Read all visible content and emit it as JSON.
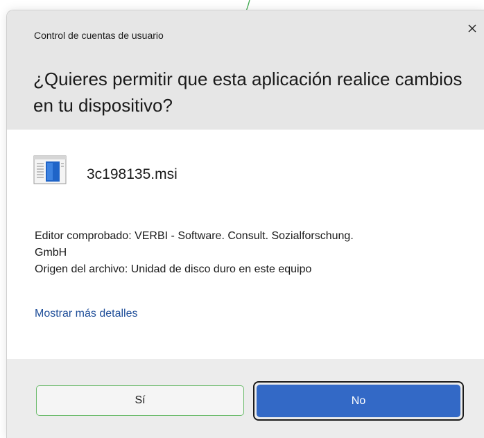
{
  "dialog": {
    "window_title": "Control de cuentas de usuario",
    "heading": "¿Quieres permitir que esta aplicación realice cambios en tu dispositivo?",
    "close_icon": "close-icon"
  },
  "app": {
    "icon": "installer-icon",
    "name": "3c198135.msi"
  },
  "info": {
    "publisher_line1": "Editor comprobado: VERBI - Software. Consult. Sozialforschung.",
    "publisher_line2": "GmbH",
    "origin": "Origen del archivo: Unidad de disco duro en este equipo"
  },
  "link": {
    "more_details": "Mostrar más detalles"
  },
  "buttons": {
    "yes": "Sí",
    "no": "No"
  },
  "colors": {
    "header_bg": "#e6e6e6",
    "footer_bg": "#ececec",
    "link": "#1f4e99",
    "primary_button": "#3369c6",
    "yes_button_border": "#6cbb6c"
  }
}
